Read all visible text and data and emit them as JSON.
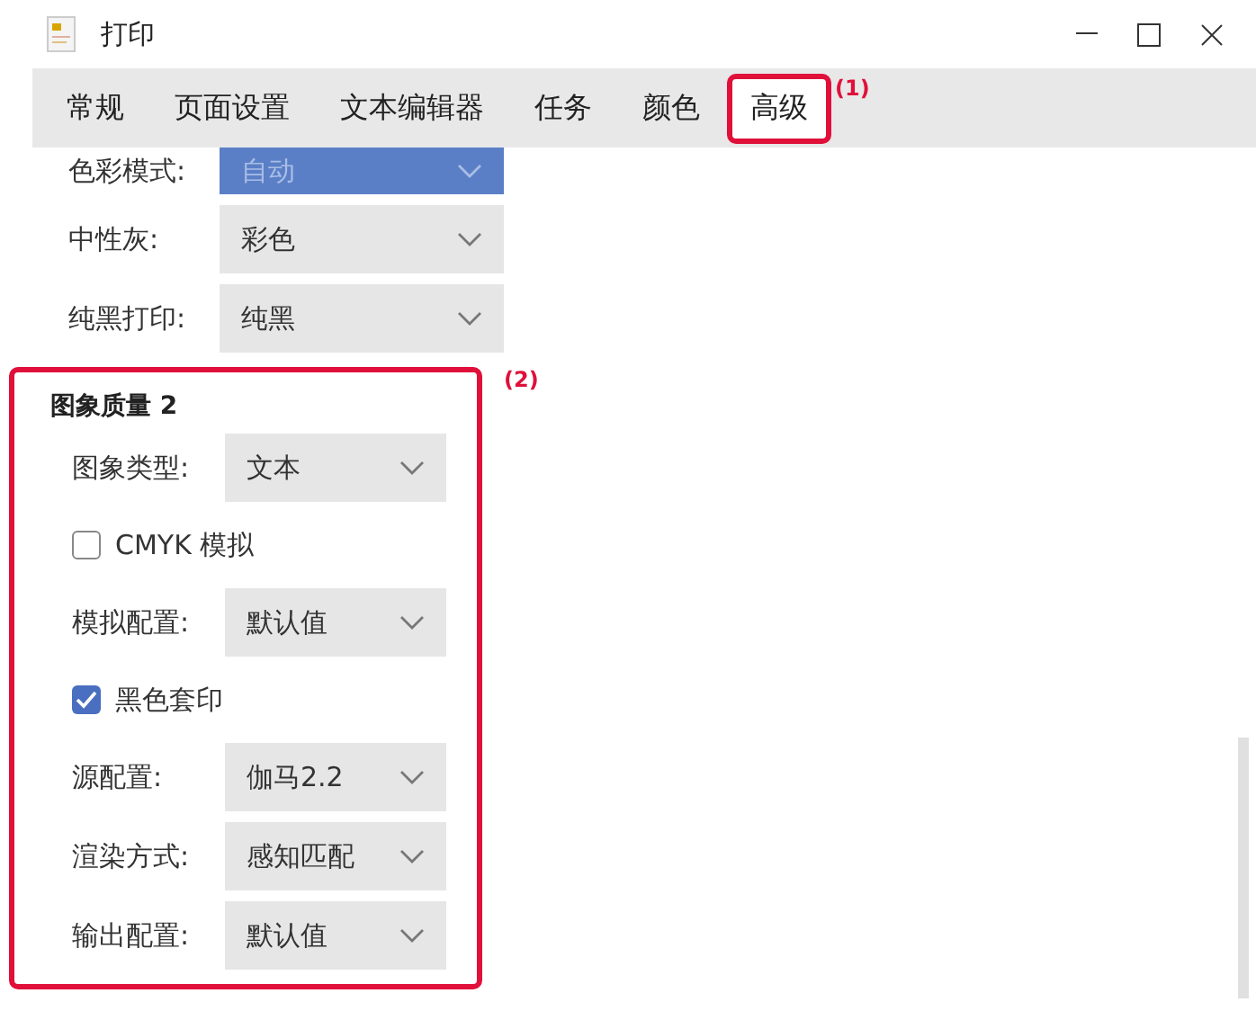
{
  "window": {
    "title": "打印"
  },
  "tabs": [
    {
      "label": "常规",
      "selected": false
    },
    {
      "label": "页面设置",
      "selected": false
    },
    {
      "label": "文本编辑器",
      "selected": false
    },
    {
      "label": "任务",
      "selected": false
    },
    {
      "label": "颜色",
      "selected": false
    },
    {
      "label": "高级",
      "selected": true,
      "callout": "(1)"
    }
  ],
  "color_section": {
    "rows": [
      {
        "label": "色彩模式:",
        "value": "自动",
        "selected": true
      },
      {
        "label": "中性灰:",
        "value": "彩色",
        "selected": false
      },
      {
        "label": "纯黑打印:",
        "value": "纯黑",
        "selected": false
      }
    ]
  },
  "image_quality": {
    "title": "图象质量 2",
    "callout": "(2)",
    "items": [
      {
        "kind": "select",
        "label": "图象类型:",
        "value": "文本"
      },
      {
        "kind": "checkbox",
        "label": "CMYK 模拟",
        "checked": false
      },
      {
        "kind": "select",
        "label": "模拟配置:",
        "value": "默认值"
      },
      {
        "kind": "checkbox",
        "label": "黑色套印",
        "checked": true
      },
      {
        "kind": "select",
        "label": "源配置:",
        "value": "伽马2.2"
      },
      {
        "kind": "select",
        "label": "渲染方式:",
        "value": "感知匹配"
      },
      {
        "kind": "select",
        "label": "输出配置:",
        "value": "默认值"
      }
    ]
  }
}
